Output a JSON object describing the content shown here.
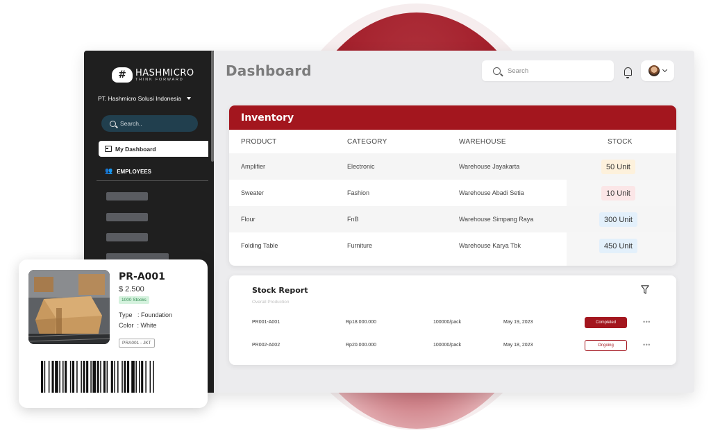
{
  "brand": {
    "name": "HASHMICRO",
    "tagline": "THINK FORWARD",
    "accent": "#a3161e"
  },
  "sidebar": {
    "company": "PT. Hashmicro Solusi Indonesia",
    "search_placeholder": "Search..",
    "items": [
      {
        "label": "My Dashboard",
        "icon": "dashboard-icon",
        "active": true
      },
      {
        "label": "EMPLOYEES",
        "icon": "people-icon"
      }
    ]
  },
  "header": {
    "title": "Dashboard",
    "search_placeholder": "Search"
  },
  "inventory": {
    "title": "Inventory",
    "columns": [
      "PRODUCT",
      "CATEGORY",
      "WAREHOUSE",
      "STOCK"
    ],
    "rows": [
      {
        "product": "Amplifier",
        "category": "Electronic",
        "warehouse": "Warehouse Jayakarta",
        "stock": "50 Unit",
        "badge_color": "#fdf1dc"
      },
      {
        "product": "Sweater",
        "category": "Fashion",
        "warehouse": "Warehouse Abadi Setia",
        "stock": "10 Unit",
        "badge_color": "#fbe6e7"
      },
      {
        "product": "Flour",
        "category": "FnB",
        "warehouse": "Warehouse Simpang Raya",
        "stock": "300 Unit",
        "badge_color": "#e3f0fb"
      },
      {
        "product": "Folding Table",
        "category": "Furniture",
        "warehouse": "Warehouse Karya Tbk",
        "stock": "450 Unit",
        "badge_color": "#e3f0fb"
      }
    ]
  },
  "stock_report": {
    "title": "Stock Report",
    "subtitle": "Overall Production",
    "rows": [
      {
        "id": "PR001-A001",
        "amount": "Rp18.000.000",
        "qty": "100000/pack",
        "date": "May 19, 2023",
        "status": "Completed"
      },
      {
        "id": "PR002-A002",
        "amount": "Rp20.000.000",
        "qty": "100000/pack",
        "date": "May 18, 2023",
        "status": "Ongoing"
      }
    ]
  },
  "product_card": {
    "name": "PR-A001",
    "price": "$ 2.500",
    "stock_badge": "1000 Stocks",
    "type_line": "Type   : Foundation",
    "color_line": "Color  : White",
    "tag": "PRA001 - JKT"
  }
}
